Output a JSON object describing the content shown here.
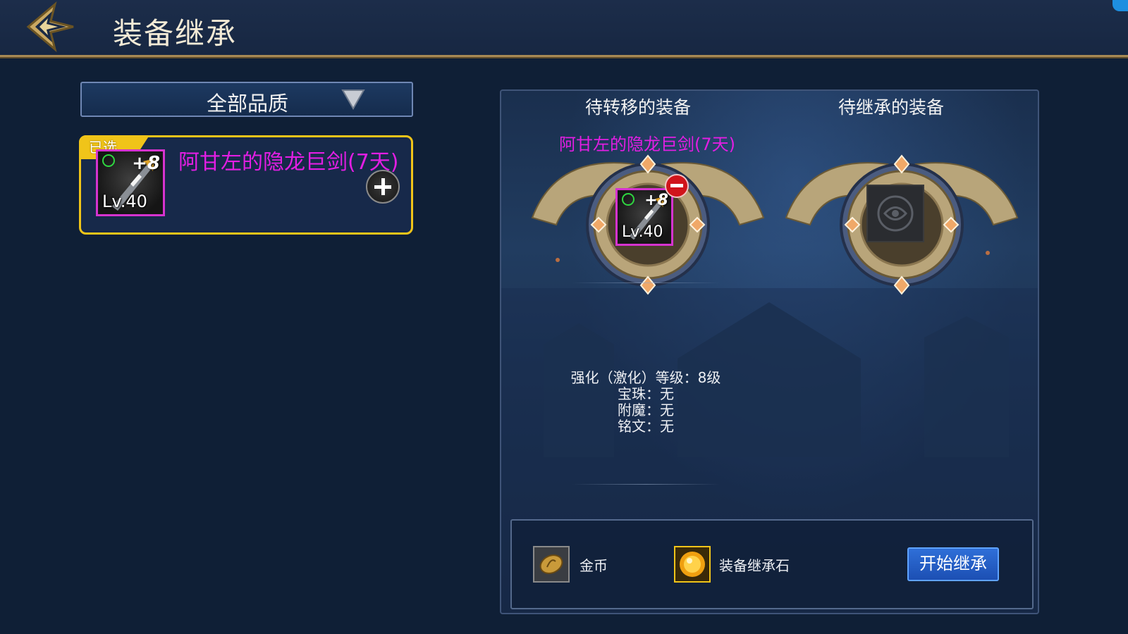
{
  "header": {
    "title": "装备继承"
  },
  "filter": {
    "selected": "全部品质"
  },
  "item_list": [
    {
      "tag": "已选",
      "name": "阿甘左的隐龙巨剑(7天)",
      "plus": "+8",
      "level": "Lv.40"
    }
  ],
  "panel": {
    "source_title": "待转移的装备",
    "target_title": "待继承的装备",
    "source_item": {
      "name": "阿甘左的隐龙巨剑(7天)",
      "plus": "+8",
      "level": "Lv.40"
    },
    "attributes": [
      "强化（激化）等级：8级",
      "宝珠：无",
      "附魔：无",
      "铭文：无"
    ]
  },
  "costs": {
    "gold_label": "金币",
    "stone_label": "装备继承石",
    "start_label": "开始继承"
  },
  "colors": {
    "item_name": "#e21ee3",
    "selected_border": "#f0c419",
    "start_button": "#2f6fd8"
  }
}
